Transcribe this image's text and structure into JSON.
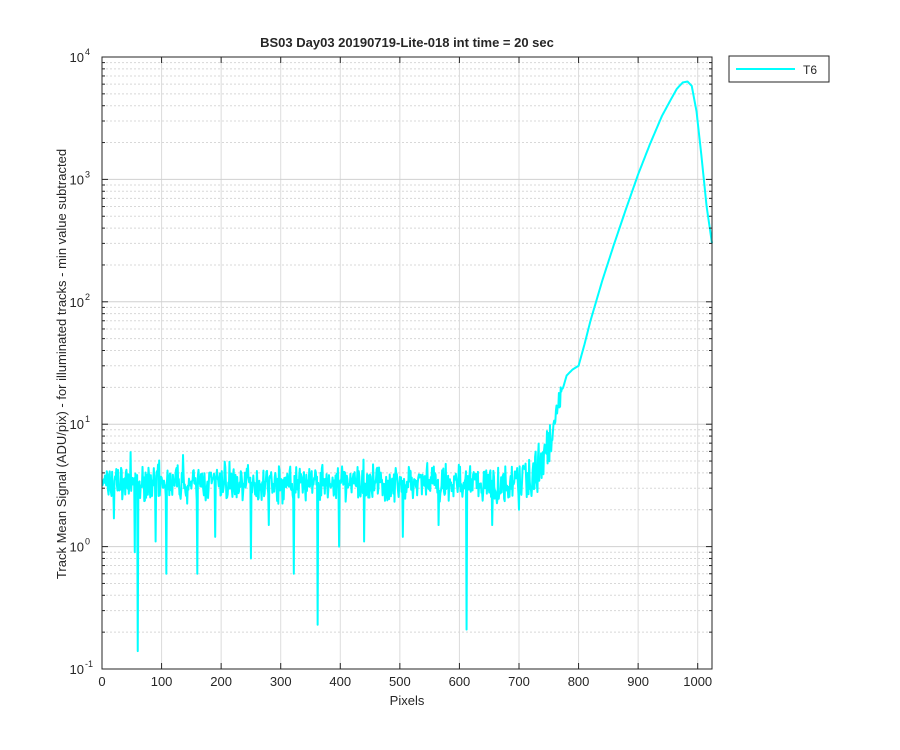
{
  "chart_data": {
    "type": "line",
    "title": "BS03 Day03 20190719-Lite-018 int time = 20 sec",
    "xlabel": "Pixels",
    "ylabel": "Track Mean Signal (ADU/pix) - for illuminated tracks - min value subtracted",
    "xlim": [
      0,
      1024
    ],
    "ylim": [
      0.1,
      10000
    ],
    "yscale": "log",
    "grid": true,
    "minor_grid": true,
    "legend_position": "outside-top-right",
    "x_ticks": [
      "0",
      "100",
      "200",
      "300",
      "400",
      "500",
      "600",
      "700",
      "800",
      "900",
      "1000"
    ],
    "y_ticks": [
      {
        "base": "10",
        "exp": "-1"
      },
      {
        "base": "10",
        "exp": "0"
      },
      {
        "base": "10",
        "exp": "1"
      },
      {
        "base": "10",
        "exp": "2"
      },
      {
        "base": "10",
        "exp": "3"
      },
      {
        "base": "10",
        "exp": "4"
      }
    ],
    "series": [
      {
        "name": "T6",
        "color": "#00ffff",
        "noise_region": {
          "x_range": [
            0,
            710
          ],
          "typical_value": 3.3,
          "typical_range": [
            2.2,
            4.8
          ]
        },
        "spikes": [
          {
            "x": 60,
            "y": 0.14
          },
          {
            "x": 362,
            "y": 0.23
          },
          {
            "x": 612,
            "y": 0.21
          },
          {
            "x": 55,
            "y": 0.9
          },
          {
            "x": 108,
            "y": 0.6
          },
          {
            "x": 160,
            "y": 0.6
          },
          {
            "x": 250,
            "y": 0.8
          },
          {
            "x": 322,
            "y": 0.6
          },
          {
            "x": 90,
            "y": 1.1
          },
          {
            "x": 440,
            "y": 1.1
          },
          {
            "x": 505,
            "y": 1.2
          },
          {
            "x": 20,
            "y": 1.7
          },
          {
            "x": 190,
            "y": 1.2
          },
          {
            "x": 280,
            "y": 1.5
          },
          {
            "x": 398,
            "y": 1.0
          },
          {
            "x": 565,
            "y": 1.5
          },
          {
            "x": 655,
            "y": 1.5
          },
          {
            "x": 700,
            "y": 2.0
          }
        ],
        "profile": [
          {
            "x": 710,
            "y": 3.6
          },
          {
            "x": 730,
            "y": 4.2
          },
          {
            "x": 745,
            "y": 5.8
          },
          {
            "x": 760,
            "y": 11
          },
          {
            "x": 770,
            "y": 17
          },
          {
            "x": 780,
            "y": 25
          },
          {
            "x": 790,
            "y": 28
          },
          {
            "x": 800,
            "y": 30
          },
          {
            "x": 810,
            "y": 45
          },
          {
            "x": 820,
            "y": 70
          },
          {
            "x": 840,
            "y": 150
          },
          {
            "x": 860,
            "y": 300
          },
          {
            "x": 880,
            "y": 580
          },
          {
            "x": 900,
            "y": 1100
          },
          {
            "x": 920,
            "y": 1950
          },
          {
            "x": 940,
            "y": 3300
          },
          {
            "x": 955,
            "y": 4500
          },
          {
            "x": 965,
            "y": 5500
          },
          {
            "x": 975,
            "y": 6200
          },
          {
            "x": 983,
            "y": 6300
          },
          {
            "x": 990,
            "y": 5800
          },
          {
            "x": 998,
            "y": 3600
          },
          {
            "x": 1006,
            "y": 1600
          },
          {
            "x": 1015,
            "y": 600
          },
          {
            "x": 1024,
            "y": 300
          }
        ]
      }
    ]
  }
}
